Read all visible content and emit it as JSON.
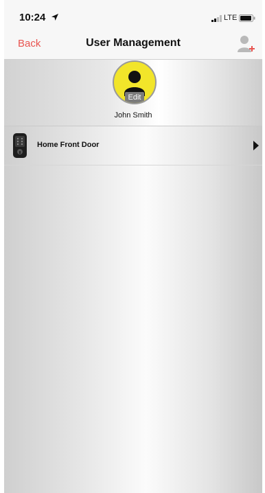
{
  "status_bar": {
    "time": "10:24",
    "network": "LTE"
  },
  "nav": {
    "back_label": "Back",
    "title": "User Management"
  },
  "profile": {
    "edit_label": "Edit",
    "name": "John Smith"
  },
  "locks": [
    {
      "name": "Home Front Door"
    }
  ],
  "colors": {
    "accent": "#e8534f",
    "avatar_bg": "#f2e52a"
  },
  "icons": {
    "location": "location-arrow-icon",
    "signal": "signal-icon",
    "battery": "battery-icon",
    "add_user": "add-user-icon",
    "avatar": "person-icon",
    "lock": "smart-lock-icon",
    "chevron": "chevron-right-icon"
  }
}
